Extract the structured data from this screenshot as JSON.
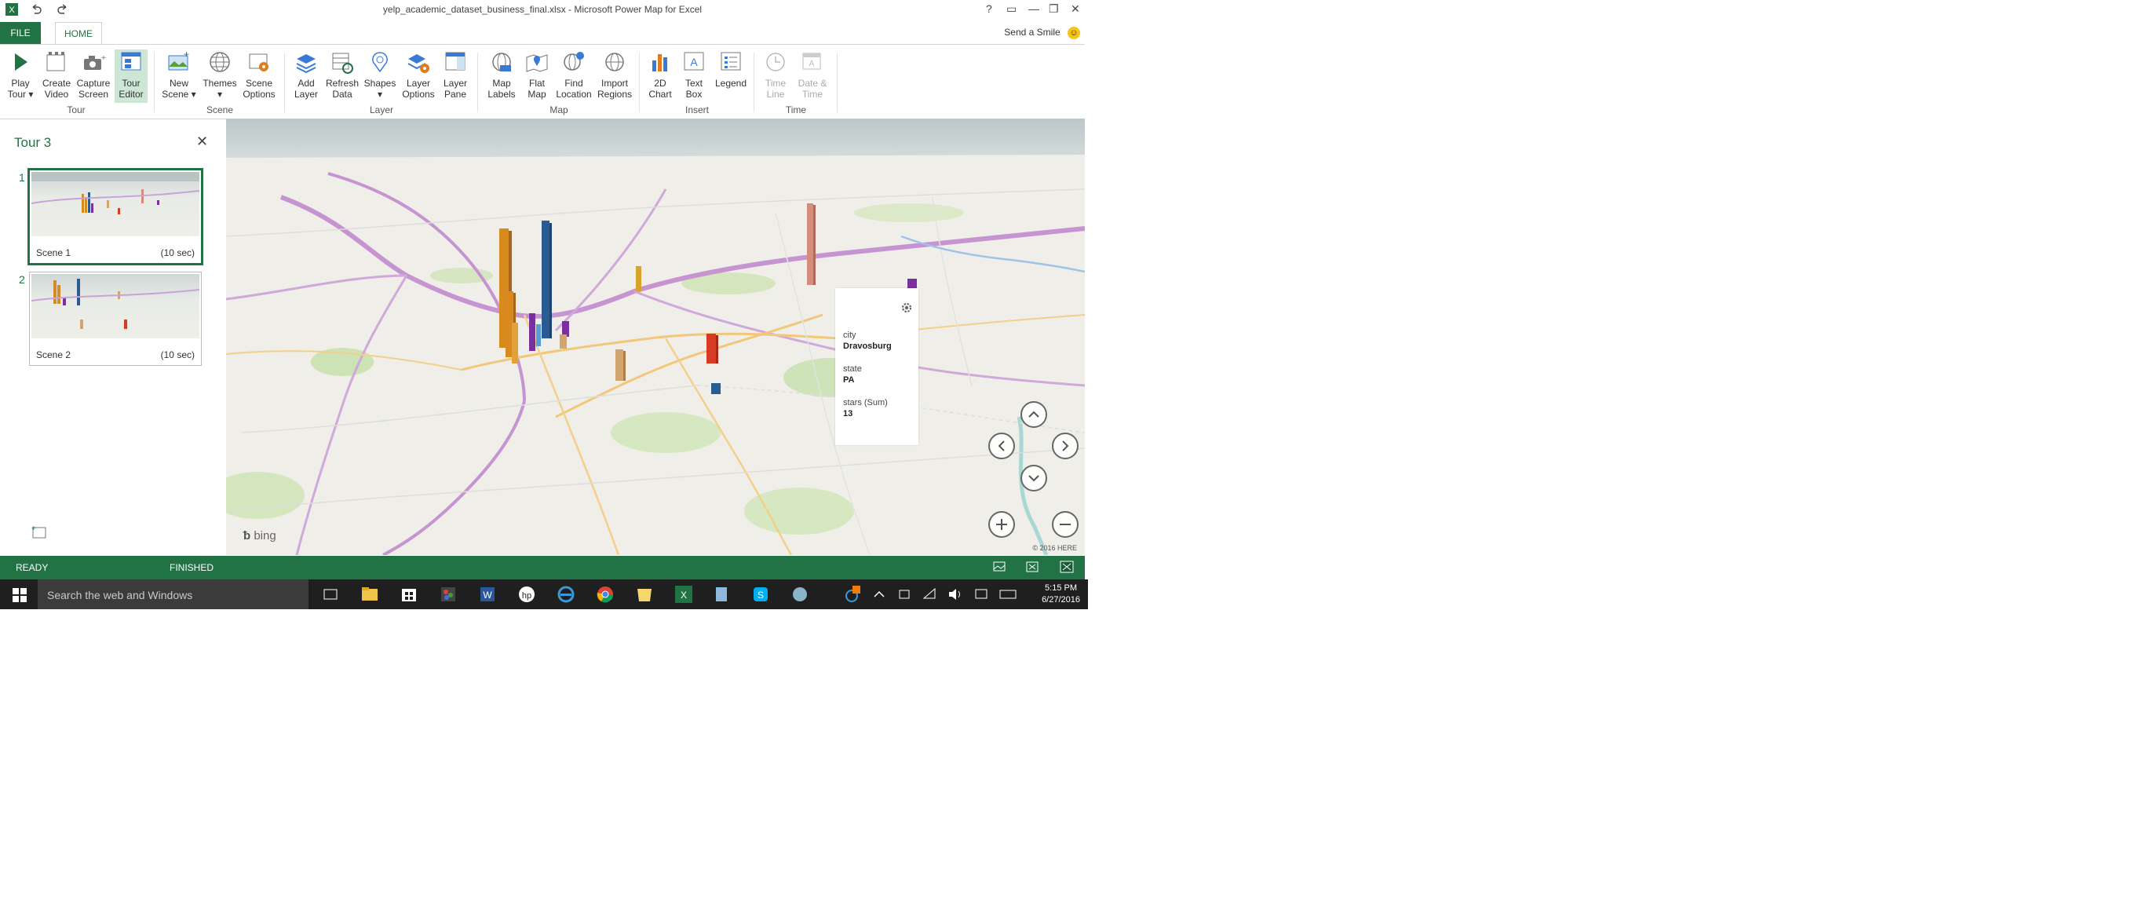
{
  "window": {
    "title": "yelp_academic_dataset_business_final.xlsx - Microsoft Power Map for Excel",
    "controls": [
      "?",
      "▭",
      "—",
      "❐",
      "✕"
    ]
  },
  "tabs": {
    "file": "FILE",
    "home": "HOME"
  },
  "send_smile": "Send a Smile",
  "ribbon": {
    "groups": [
      {
        "label": "Tour",
        "buttons": [
          {
            "line1": "Play",
            "line2": "Tour ▾",
            "icon": "play-icon"
          },
          {
            "line1": "Create",
            "line2": "Video",
            "icon": "video-icon"
          },
          {
            "line1": "Capture",
            "line2": "Screen",
            "icon": "camera-icon"
          },
          {
            "line1": "Tour",
            "line2": "Editor",
            "icon": "tour-editor-icon"
          }
        ]
      },
      {
        "label": "Scene",
        "buttons": [
          {
            "line1": "New",
            "line2": "Scene ▾",
            "icon": "new-scene-icon"
          },
          {
            "line1": "Themes",
            "line2": "▾",
            "icon": "globe-icon"
          },
          {
            "line1": "Scene",
            "line2": "Options",
            "icon": "scene-options-icon"
          }
        ]
      },
      {
        "label": "Layer",
        "buttons": [
          {
            "line1": "Add",
            "line2": "Layer",
            "icon": "add-layer-icon"
          },
          {
            "line1": "Refresh",
            "line2": "Data",
            "icon": "refresh-icon"
          },
          {
            "line1": "Shapes",
            "line2": "▾",
            "icon": "shapes-icon"
          },
          {
            "line1": "Layer",
            "line2": "Options",
            "icon": "layer-options-icon"
          },
          {
            "line1": "Layer",
            "line2": "Pane",
            "icon": "layer-pane-icon"
          }
        ]
      },
      {
        "label": "Map",
        "buttons": [
          {
            "line1": "Map",
            "line2": "Labels",
            "icon": "map-labels-icon"
          },
          {
            "line1": "Flat",
            "line2": "Map",
            "icon": "flat-map-icon"
          },
          {
            "line1": "Find",
            "line2": "Location",
            "icon": "find-location-icon"
          },
          {
            "line1": "Import",
            "line2": "Regions",
            "icon": "import-regions-icon"
          }
        ]
      },
      {
        "label": "Insert",
        "buttons": [
          {
            "line1": "2D",
            "line2": "Chart",
            "icon": "chart-icon"
          },
          {
            "line1": "Text",
            "line2": "Box",
            "icon": "text-box-icon"
          },
          {
            "line1": "Legend",
            "line2": "",
            "icon": "legend-icon"
          }
        ]
      },
      {
        "label": "Time",
        "buttons": [
          {
            "line1": "Time",
            "line2": "Line",
            "icon": "timeline-icon"
          },
          {
            "line1": "Date &",
            "line2": "Time",
            "icon": "date-time-icon"
          }
        ]
      }
    ]
  },
  "tour": {
    "title": "Tour 3",
    "scenes": [
      {
        "number": "1",
        "name": "Scene 1",
        "duration": "(10 sec)"
      },
      {
        "number": "2",
        "name": "Scene 2",
        "duration": "(10 sec)"
      }
    ]
  },
  "map": {
    "bing": "bing",
    "copyright": "© 2016 HERE"
  },
  "tooltip": {
    "fields": [
      {
        "label": "city",
        "value": "Dravosburg"
      },
      {
        "label": "state",
        "value": "PA"
      },
      {
        "label": "stars (Sum)",
        "value": "13"
      }
    ]
  },
  "status": {
    "ready": "READY",
    "finished": "FINISHED"
  },
  "taskbar": {
    "search_placeholder": "Search the web and Windows",
    "time": "5:15 PM",
    "date": "6/27/2016"
  },
  "colors": {
    "excel_green": "#217346",
    "orange_bar": "#d98a1e",
    "blue_bar": "#2a5c93",
    "purple_bar": "#7a2fa0",
    "red_bar": "#d93a25",
    "salmon_bar": "#d58c7a",
    "tan_bar": "#d2a46e"
  }
}
